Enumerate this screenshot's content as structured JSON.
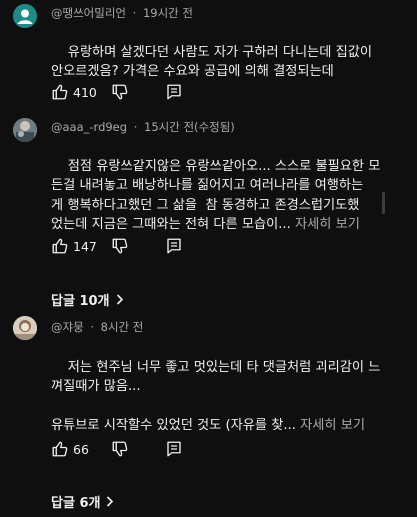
{
  "comments": [
    {
      "author": "@땡쓰어밀리언",
      "time": "19시간 전",
      "text": "유랑하며 살겠다던 사람도 자가 구하러 다니는데 집값이\n안오르겠음? 가격은 수요와 공급에 의해 결정되는데",
      "more": "",
      "likes": "410"
    },
    {
      "author": "@aaa_-rd9eg",
      "time": "15시간 전(수정됨)",
      "text": "점점 유랑쓰같지않은 유랑쓰같아오... 스스로 불필요한 모\n든걸 내려놓고 배낭하나를 짊어지고 여러나라를 여행하는\n게 행복하다고했던 그 삶을  참 동경하고 존경스럽기도했\n었는데 지금은 그때와는 전혀 다른 모습이...",
      "more": "자세히 보기",
      "likes": "147",
      "replies": "답글 10개"
    },
    {
      "author": "@쟈뭉",
      "time": "8시간 전",
      "text": "저는 현주님 너무 좋고 멋있는데 타 댓글처럼 괴리감이 느\n껴질때가 많음...\n\n유튜브로 시작할수 있었던 것도 (자유를 찾...",
      "more": "자세히 보기",
      "likes": "66",
      "replies": "답글 6개"
    }
  ],
  "icons": {
    "like": "thumbs-up-icon",
    "dislike": "thumbs-down-icon",
    "reply": "reply-icon",
    "chevron": "chevron-right-icon"
  },
  "colors": {
    "background": "#0f0f0f",
    "text": "#f1f1f1",
    "secondary": "#aaaaaa",
    "avatar1": "#1f8f8a"
  }
}
